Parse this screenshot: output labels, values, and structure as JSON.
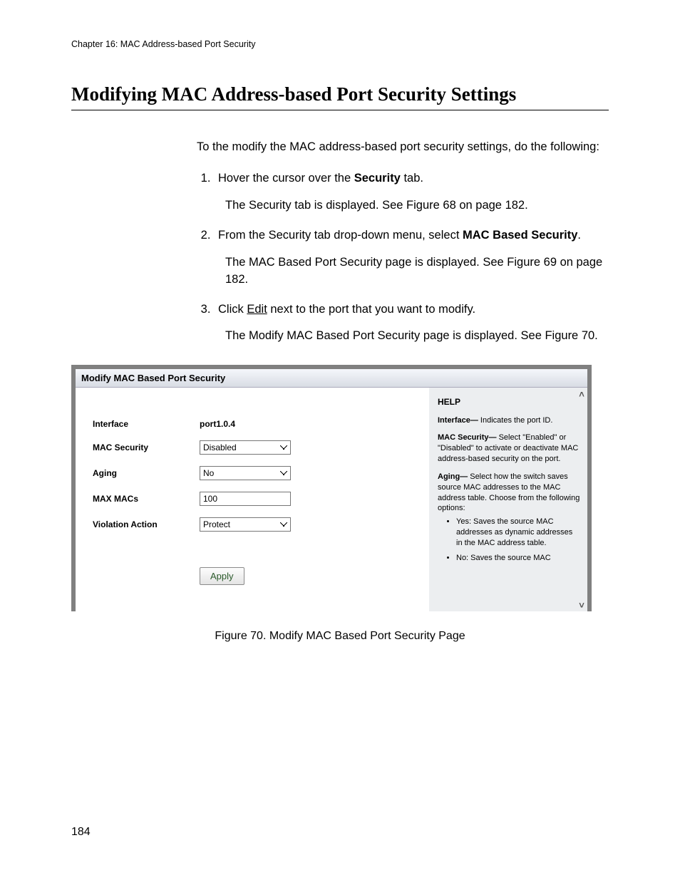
{
  "header": {
    "chapter": "Chapter 16: MAC Address-based Port Security"
  },
  "section": {
    "title": "Modifying MAC Address-based Port Security Settings"
  },
  "body": {
    "intro": "To the modify the MAC address-based port security settings, do the following:",
    "steps": {
      "s1_pre": "Hover the cursor over the ",
      "s1_bold": "Security",
      "s1_post": " tab.",
      "s1_after": "The Security tab is displayed. See Figure 68 on page 182.",
      "s2_pre": "From the Security tab drop-down menu, select ",
      "s2_bold": "MAC Based Security",
      "s2_post": ".",
      "s2_after": "The MAC Based Port Security page is displayed. See Figure 69 on page 182.",
      "s3_pre": "Click ",
      "s3_underline": "Edit",
      "s3_post": " next to the port that you want to modify.",
      "s3_after": "The Modify MAC Based Port Security page is displayed. See Figure 70."
    }
  },
  "figure": {
    "caption": "Figure 70. Modify MAC Based Port Security Page",
    "panel_title": "Modify MAC Based Port Security",
    "form": {
      "interface_label": "Interface",
      "interface_value": "port1.0.4",
      "mac_security_label": "MAC Security",
      "mac_security_value": "Disabled",
      "aging_label": "Aging",
      "aging_value": "No",
      "max_macs_label": "MAX MACs",
      "max_macs_value": "100",
      "violation_label": "Violation Action",
      "violation_value": "Protect",
      "apply_label": "Apply"
    },
    "help": {
      "title": "HELP",
      "interface_b": "Interface—",
      "interface_t": " Indicates the port ID.",
      "mac_b": "MAC Security—",
      "mac_t": " Select \"Enabled\" or \"Disabled\" to activate or deactivate MAC address-based security on the port.",
      "aging_b": "Aging—",
      "aging_t": " Select how the switch saves source MAC addresses to the MAC address table. Choose from the following options:",
      "bullet_yes": "Yes: Saves the source MAC addresses as dynamic addresses in the MAC address table.",
      "bullet_no": "No: Saves the source MAC"
    }
  },
  "page_number": "184"
}
